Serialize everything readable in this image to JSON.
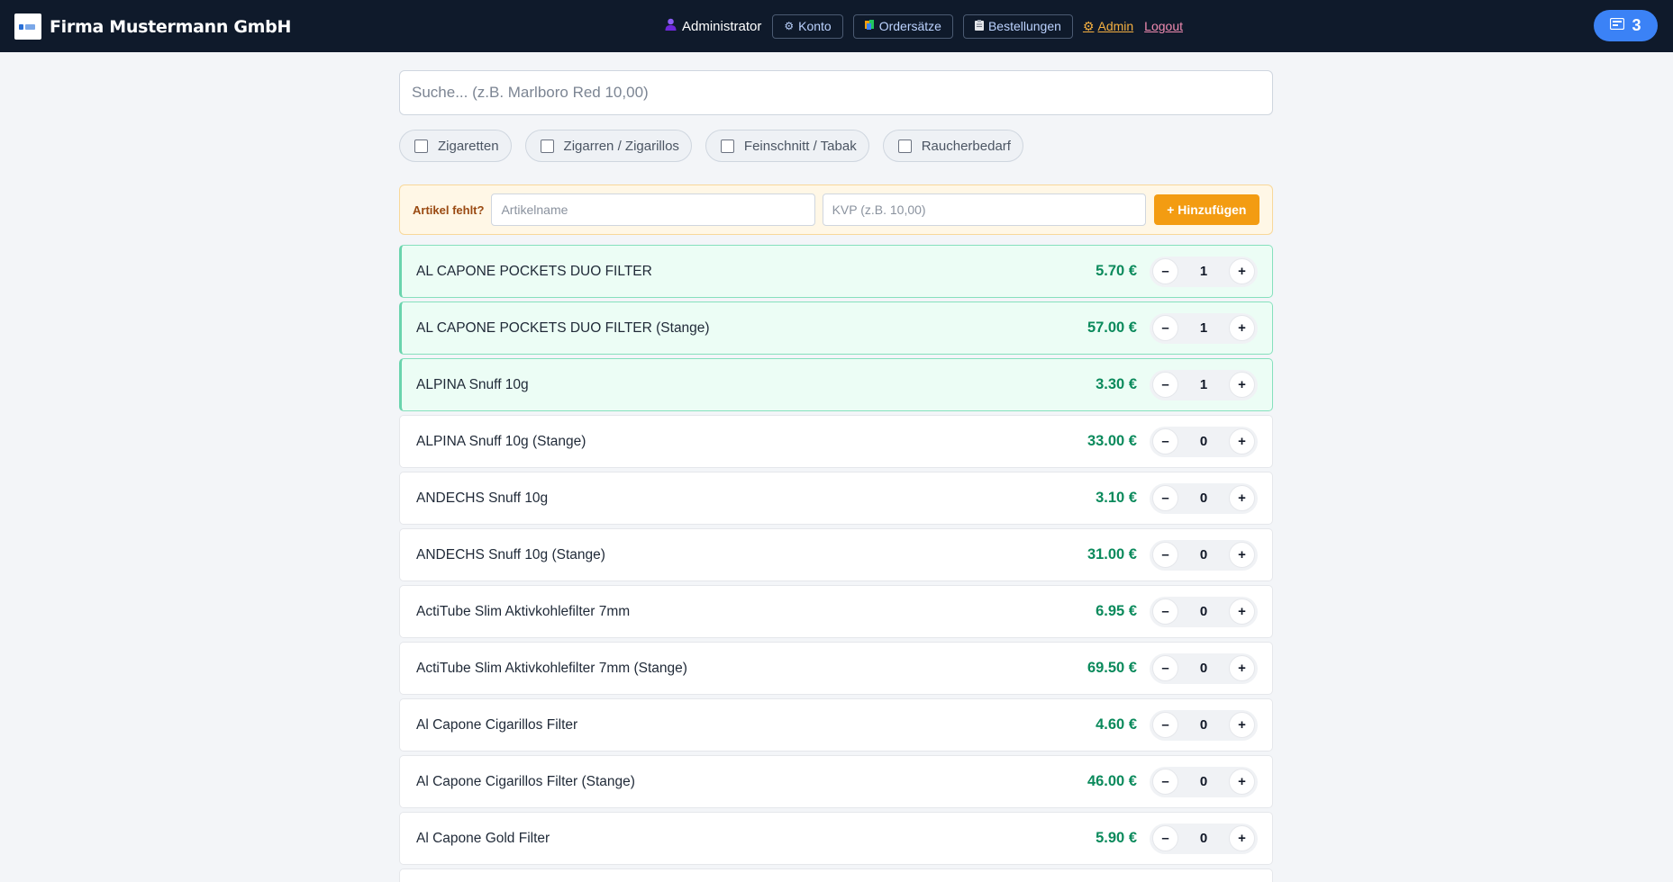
{
  "header": {
    "brand": "Firma Mustermann GmbH",
    "user": "Administrator",
    "nav": [
      {
        "label": "Konto",
        "icon": "gear-icon"
      },
      {
        "label": "Ordersätze",
        "icon": "books-icon"
      },
      {
        "label": "Bestellungen",
        "icon": "clipboard-icon"
      }
    ],
    "admin": "Admin",
    "logout": "Logout",
    "cart_count": "3"
  },
  "search": {
    "placeholder": "Suche... (z.B. Marlboro Red 10,00)"
  },
  "filters": [
    "Zigaretten",
    "Zigarren / Zigarillos",
    "Feinschnitt / Tabak",
    "Raucherbedarf"
  ],
  "missing": {
    "label": "Artikel fehlt?",
    "name_placeholder": "Artikelname",
    "kvp_placeholder": "KVP (z.B. 10,00)",
    "add_label": "+ Hinzufügen"
  },
  "products": [
    {
      "name": "AL CAPONE POCKETS DUO FILTER",
      "price": "5.70 €",
      "qty": "1",
      "selected": true
    },
    {
      "name": "AL CAPONE POCKETS DUO FILTER (Stange)",
      "price": "57.00 €",
      "qty": "1",
      "selected": true
    },
    {
      "name": "ALPINA Snuff 10g",
      "price": "3.30 €",
      "qty": "1",
      "selected": true
    },
    {
      "name": "ALPINA Snuff 10g (Stange)",
      "price": "33.00 €",
      "qty": "0",
      "selected": false
    },
    {
      "name": "ANDECHS Snuff 10g",
      "price": "3.10 €",
      "qty": "0",
      "selected": false
    },
    {
      "name": "ANDECHS Snuff 10g (Stange)",
      "price": "31.00 €",
      "qty": "0",
      "selected": false
    },
    {
      "name": "ActiTube Slim Aktivkohlefilter 7mm",
      "price": "6.95 €",
      "qty": "0",
      "selected": false
    },
    {
      "name": "ActiTube Slim Aktivkohlefilter 7mm (Stange)",
      "price": "69.50 €",
      "qty": "0",
      "selected": false
    },
    {
      "name": "Al Capone Cigarillos Filter",
      "price": "4.60 €",
      "qty": "0",
      "selected": false
    },
    {
      "name": "Al Capone Cigarillos Filter (Stange)",
      "price": "46.00 €",
      "qty": "0",
      "selected": false
    },
    {
      "name": "Al Capone Gold Filter",
      "price": "5.90 €",
      "qty": "0",
      "selected": false
    }
  ],
  "qty_minus": "–",
  "qty_plus": "+"
}
